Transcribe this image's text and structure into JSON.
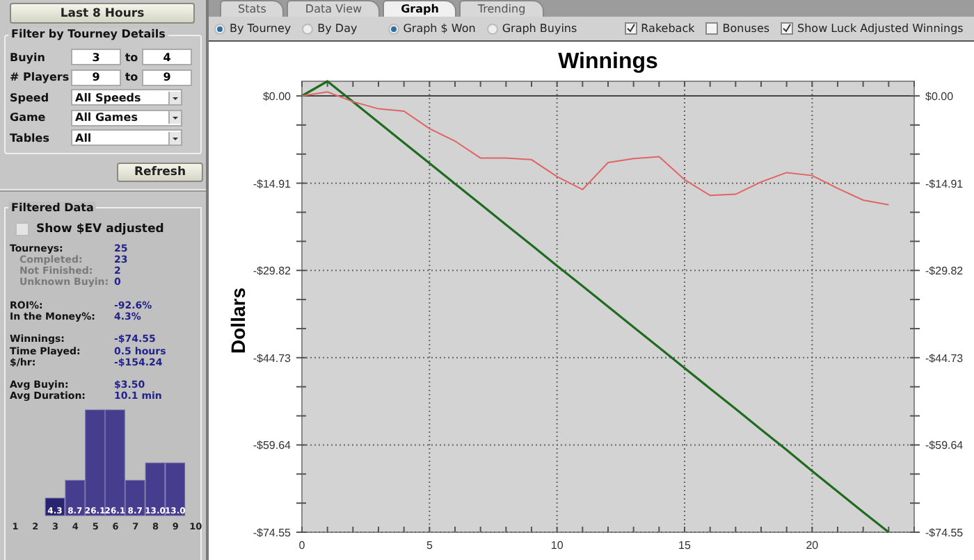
{
  "tabs": [
    {
      "label": "Stats",
      "selected": false
    },
    {
      "label": "Data View",
      "selected": false
    },
    {
      "label": "Graph",
      "selected": true
    },
    {
      "label": "Trending",
      "selected": false
    }
  ],
  "sidebar": {
    "period_button": "Last 8 Hours",
    "filter": {
      "legend": "Filter by Tourney Details",
      "ranges": [
        {
          "label": "Buyin",
          "from": "3",
          "to_label": "to",
          "to": "4"
        },
        {
          "label": "# Players",
          "from": "9",
          "to_label": "to",
          "to": "9"
        }
      ],
      "dropdowns": [
        {
          "label": "Speed",
          "value": "All Speeds"
        },
        {
          "label": "Game",
          "value": "All Games"
        },
        {
          "label": "Tables",
          "value": "All"
        }
      ]
    },
    "refresh_button": "Refresh",
    "filtered": {
      "legend": "Filtered Data",
      "ev_checkbox": {
        "label": "Show $EV adjusted",
        "checked": false
      },
      "stat_groups": [
        [
          {
            "label": "Tourneys:",
            "value": "25",
            "kind": "main"
          },
          {
            "label": "Completed:",
            "value": "23",
            "kind": "sub"
          },
          {
            "label": "Not Finished:",
            "value": "2",
            "kind": "sub"
          },
          {
            "label": "Unknown Buyin:",
            "value": "0",
            "kind": "sub"
          }
        ],
        [
          {
            "label": "ROI%:",
            "value": "-92.6%",
            "kind": "main"
          },
          {
            "label": "In the Money%:",
            "value": "4.3%",
            "kind": "main"
          }
        ],
        [
          {
            "label": "Winnings:",
            "value": "-$74.55",
            "kind": "main"
          },
          {
            "label": "Time Played:",
            "value": "0.5 hours",
            "kind": "main"
          },
          {
            "label": "$/hr:",
            "value": "-$154.24",
            "kind": "main"
          }
        ],
        [
          {
            "label": "Avg Buyin:",
            "value": "$3.50",
            "kind": "main"
          },
          {
            "label": "Avg Duration:",
            "value": "10.1 min",
            "kind": "main"
          }
        ]
      ],
      "histogram": {
        "chart_data": {
          "type": "bar",
          "categories": [
            "1",
            "2",
            "3",
            "4",
            "5",
            "6",
            "7",
            "8",
            "9",
            "10"
          ],
          "values": [
            null,
            null,
            4.3,
            8.7,
            26.1,
            26.1,
            8.7,
            13.0,
            13.0,
            null
          ],
          "value_labels": [
            null,
            null,
            "4.3",
            "8.7",
            "26.1",
            "26.1",
            "8.7",
            "13.0",
            "13.0",
            null
          ]
        }
      }
    }
  },
  "toolbar": {
    "radio_groups": [
      [
        {
          "label": "By Tourney",
          "selected": true
        },
        {
          "label": "By Day",
          "selected": false
        }
      ],
      [
        {
          "label": "Graph $ Won",
          "selected": true
        },
        {
          "label": "Graph Buyins",
          "selected": false
        }
      ]
    ],
    "checkboxes": [
      {
        "label": "Rakeback",
        "checked": true
      },
      {
        "label": "Bonuses",
        "checked": false
      },
      {
        "label": "Show Luck Adjusted Winnings",
        "checked": true
      }
    ]
  },
  "graph": {
    "chart_data": {
      "type": "line",
      "title": "Winnings",
      "ylabel": "Dollars",
      "x": [
        0,
        1,
        2,
        3,
        4,
        5,
        6,
        7,
        8,
        9,
        10,
        11,
        12,
        13,
        14,
        15,
        16,
        17,
        18,
        19,
        20,
        21,
        22,
        23
      ],
      "series": [
        {
          "color": "#1f6b1f",
          "values": [
            0,
            2.5,
            -1.0,
            -4.5,
            -8.0,
            -11.5,
            -15.0,
            -18.5,
            -22.0,
            -25.5,
            -29.0,
            -32.5,
            -36.0,
            -39.5,
            -43.0,
            -46.5,
            -50.0,
            -53.5,
            -57.0,
            -60.5,
            -64.1,
            -67.6,
            -71.1,
            -74.55
          ]
        },
        {
          "color": "#e06464",
          "values": [
            0,
            0.7,
            -1.0,
            -2.2,
            -2.6,
            -5.6,
            -7.7,
            -10.6,
            -10.6,
            -10.9,
            -13.8,
            -16.0,
            -11.4,
            -10.7,
            -10.4,
            -14.3,
            -17.0,
            -16.8,
            -14.7,
            -13.1,
            -13.6,
            -15.8,
            -17.8,
            -18.6
          ]
        }
      ],
      "grid": true,
      "xlim": [
        0,
        24
      ],
      "ylim": [
        -74.55,
        2.5
      ],
      "xticks": [
        0,
        5,
        10,
        15,
        20
      ],
      "yticks": [
        {
          "value": 0,
          "label": "$0.00"
        },
        {
          "value": -14.91,
          "label": "-$14.91"
        },
        {
          "value": -29.82,
          "label": "-$29.82"
        },
        {
          "value": -44.73,
          "label": "-$44.73"
        },
        {
          "value": -59.64,
          "label": "-$59.64"
        },
        {
          "value": -74.55,
          "label": "-$74.55"
        }
      ]
    }
  }
}
